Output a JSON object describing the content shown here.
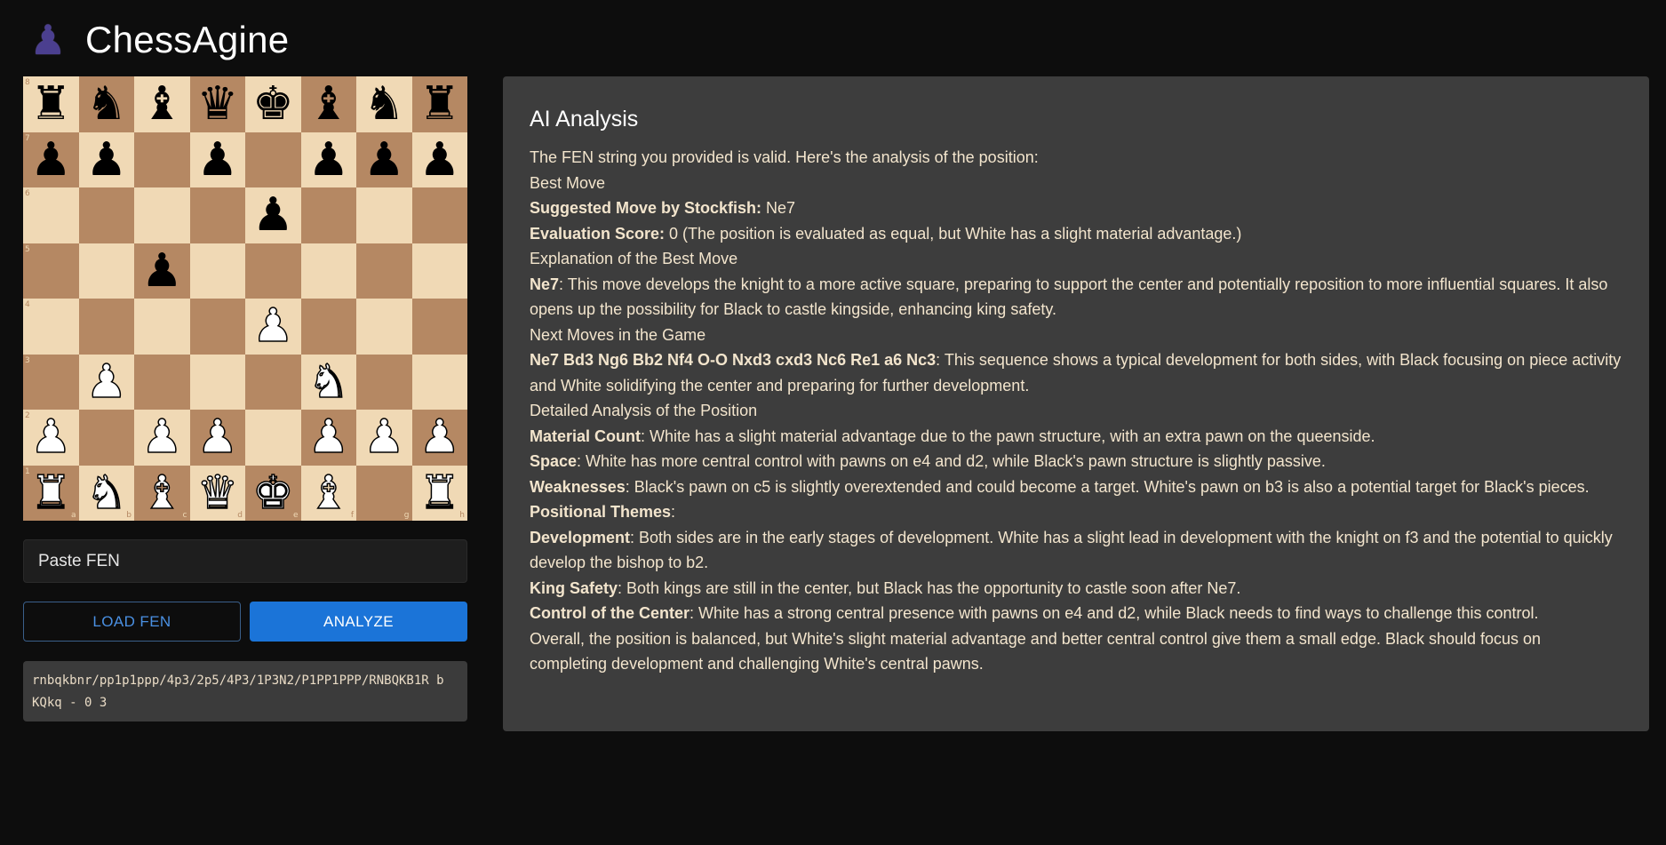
{
  "app": {
    "title": "ChessAgine",
    "logo_icon": "pawn-icon"
  },
  "board": {
    "light_color": "#f0d9b5",
    "dark_color": "#b58863",
    "ranks": [
      "8",
      "7",
      "6",
      "5",
      "4",
      "3",
      "2",
      "1"
    ],
    "files": [
      "a",
      "b",
      "c",
      "d",
      "e",
      "f",
      "g",
      "h"
    ],
    "position": [
      [
        "r",
        "n",
        "b",
        "q",
        "k",
        "b",
        "n",
        "r"
      ],
      [
        "p",
        "p",
        "",
        "p",
        "",
        "p",
        "p",
        "p"
      ],
      [
        "",
        "",
        "",
        "",
        "p",
        "",
        "",
        ""
      ],
      [
        "",
        "",
        "p",
        "",
        "",
        "",
        "",
        ""
      ],
      [
        "",
        "",
        "",
        "",
        "P",
        "",
        "",
        ""
      ],
      [
        "",
        "P",
        "",
        "",
        "",
        "N",
        "",
        ""
      ],
      [
        "P",
        "",
        "P",
        "P",
        "",
        "P",
        "P",
        "P"
      ],
      [
        "R",
        "N",
        "B",
        "Q",
        "K",
        "B",
        "",
        "R"
      ]
    ]
  },
  "controls": {
    "fen_placeholder": "Paste FEN",
    "load_label": "LOAD FEN",
    "analyze_label": "ANALYZE",
    "current_fen": "rnbqkbnr/pp1p1ppp/4p3/2p5/4P3/1P3N2/P1PP1PPP/RNBQKB1R b KQkq - 0 3"
  },
  "analysis": {
    "title": "AI Analysis",
    "lines": [
      {
        "bold": "",
        "text": "The FEN string you provided is valid. Here's the analysis of the position:"
      },
      {
        "bold": "",
        "text": "Best Move"
      },
      {
        "bold": "Suggested Move by Stockfish:",
        "text": " Ne7"
      },
      {
        "bold": "Evaluation Score:",
        "text": " 0 (The position is evaluated as equal, but White has a slight material advantage.)"
      },
      {
        "bold": "",
        "text": "Explanation of the Best Move"
      },
      {
        "bold": "Ne7",
        "text": ": This move develops the knight to a more active square, preparing to support the center and potentially reposition to more influential squares. It also opens up the possibility for Black to castle kingside, enhancing king safety."
      },
      {
        "bold": "",
        "text": "Next Moves in the Game"
      },
      {
        "bold": "Ne7 Bd3 Ng6 Bb2 Nf4 O-O Nxd3 cxd3 Nc6 Re1 a6 Nc3",
        "text": ": This sequence shows a typical development for both sides, with Black focusing on piece activity and White solidifying the center and preparing for further development."
      },
      {
        "bold": "",
        "text": "Detailed Analysis of the Position"
      },
      {
        "bold": "Material Count",
        "text": ": White has a slight material advantage due to the pawn structure, with an extra pawn on the queenside."
      },
      {
        "bold": "Space",
        "text": ": White has more central control with pawns on e4 and d2, while Black's pawn structure is slightly passive."
      },
      {
        "bold": "Weaknesses",
        "text": ": Black's pawn on c5 is slightly overextended and could become a target. White's pawn on b3 is also a potential target for Black's pieces."
      },
      {
        "bold": "Positional Themes",
        "text": ":"
      },
      {
        "bold": "Development",
        "text": ": Both sides are in the early stages of development. White has a slight lead in development with the knight on f3 and the potential to quickly develop the bishop to b2."
      },
      {
        "bold": "King Safety",
        "text": ": Both kings are still in the center, but Black has the opportunity to castle soon after Ne7."
      },
      {
        "bold": "Control of the Center",
        "text": ": White has a strong central presence with pawns on e4 and d2, while Black needs to find ways to challenge this control."
      },
      {
        "bold": "",
        "text": "Overall, the position is balanced, but White's slight material advantage and better central control give them a small edge. Black should focus on completing development and challenging White's central pawns."
      }
    ]
  }
}
